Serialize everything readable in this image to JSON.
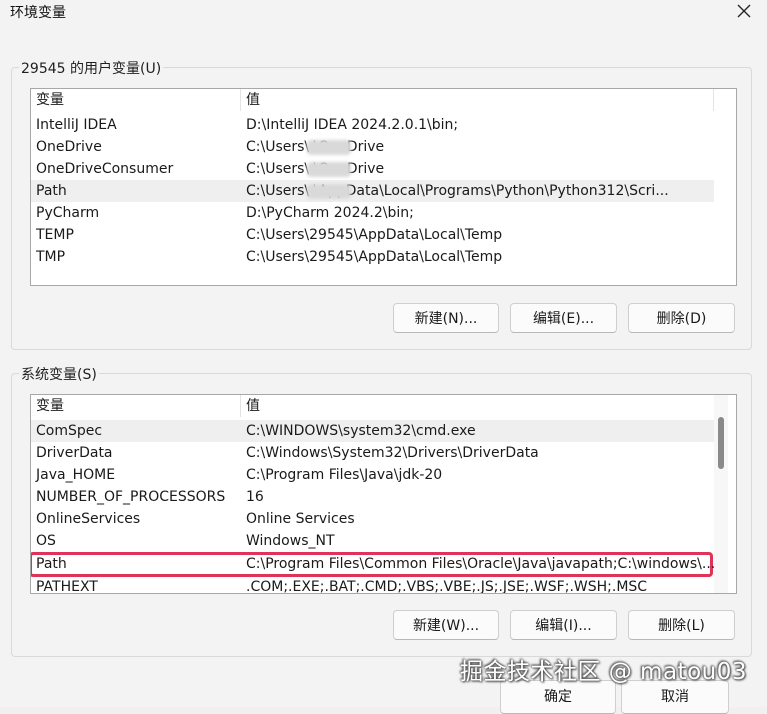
{
  "window": {
    "title": "环境变量"
  },
  "user_vars": {
    "group_label": "29545 的用户变量(U)",
    "columns": [
      "变量",
      "值"
    ],
    "rows": [
      {
        "name": "IntelliJ IDEA",
        "value": "D:\\IntelliJ IDEA 2024.2.0.1\\bin;"
      },
      {
        "name": "OneDrive",
        "value": "C:\\Users\\        \\OneDrive"
      },
      {
        "name": "OneDriveConsumer",
        "value": "C:\\Users\\        \\OneDrive"
      },
      {
        "name": "Path",
        "value": "C:\\Users\\        \\AppData\\Local\\Programs\\Python\\Python312\\Scri..."
      },
      {
        "name": "PyCharm",
        "value": "D:\\PyCharm 2024.2\\bin;"
      },
      {
        "name": "TEMP",
        "value": "C:\\Users\\29545\\AppData\\Local\\Temp"
      },
      {
        "name": "TMP",
        "value": "C:\\Users\\29545\\AppData\\Local\\Temp"
      }
    ],
    "buttons": {
      "new": "新建(N)...",
      "edit": "编辑(E)...",
      "delete": "删除(D)"
    }
  },
  "system_vars": {
    "group_label": "系统变量(S)",
    "columns": [
      "变量",
      "值"
    ],
    "rows": [
      {
        "name": "ComSpec",
        "value": "C:\\WINDOWS\\system32\\cmd.exe"
      },
      {
        "name": "DriverData",
        "value": "C:\\Windows\\System32\\Drivers\\DriverData"
      },
      {
        "name": "Java_HOME",
        "value": "C:\\Program Files\\Java\\jdk-20"
      },
      {
        "name": "NUMBER_OF_PROCESSORS",
        "value": "16"
      },
      {
        "name": "OnlineServices",
        "value": "Online Services"
      },
      {
        "name": "OS",
        "value": "Windows_NT"
      },
      {
        "name": "Path",
        "value": "C:\\Program Files\\Common Files\\Oracle\\Java\\javapath;C:\\windows\\..."
      },
      {
        "name": "PATHEXT",
        "value": ".COM;.EXE;.BAT;.CMD;.VBS;.VBE;.JS;.JSE;.WSF;.WSH;.MSC"
      }
    ],
    "buttons": {
      "new": "新建(W)...",
      "edit": "编辑(I)...",
      "delete": "删除(L)"
    }
  },
  "footer": {
    "ok": "确定",
    "cancel": "取消"
  },
  "watermark": "掘金技术社区 @ matou03",
  "colors": {
    "highlight": "#e0335a",
    "selected_row": "#efefef",
    "background": "#f3f3f3"
  },
  "icons": {
    "close": "close-icon"
  }
}
